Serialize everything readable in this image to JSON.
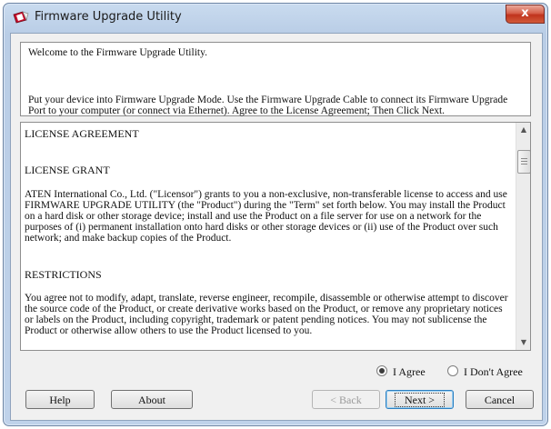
{
  "window": {
    "title": "Firmware Upgrade Utility",
    "close_label": "x"
  },
  "intro": {
    "line1": "Welcome to the Firmware Upgrade Utility.",
    "line2": "Put your device into Firmware Upgrade Mode. Use the Firmware Upgrade Cable to connect its Firmware Upgrade Port to your computer (or connect via Ethernet). Agree to the License Agreement; Then Click Next."
  },
  "license": {
    "heading": "LICENSE AGREEMENT",
    "grant_heading": "LICENSE GRANT",
    "grant_text": "ATEN International Co., Ltd. (\"Licensor\") grants to you a non-exclusive, non-transferable license to access and use FIRMWARE UPGRADE UTILITY (the \"Product\") during the \"Term\" set forth below. You may install the Product on a hard disk or other storage device; install and use the Product on a file server for use on a network for the purposes of (i) permanent installation onto hard disks or other storage devices or (ii) use of the Product over such network; and make backup copies of the Product.",
    "restrictions_heading": "RESTRICTIONS",
    "restrictions_text": "You agree not to modify, adapt, translate, reverse engineer, recompile, disassemble or otherwise attempt to discover the source code of the Product, or create derivative works based on the Product, or remove any proprietary notices or labels on the Product, including copyright, trademark or patent pending notices. You may not sublicense the Product or otherwise allow others to use the Product licensed to you."
  },
  "agreement": {
    "agree_label": "I Agree",
    "disagree_label": "I Don't Agree",
    "selected": "agree"
  },
  "buttons": {
    "help": "Help",
    "about": "About",
    "back": "< Back",
    "next": "Next >",
    "cancel": "Cancel"
  },
  "colors": {
    "title_gradient": "#c9dbef",
    "close_button": "#c0331d",
    "default_button_border": "#2d7fc0"
  }
}
